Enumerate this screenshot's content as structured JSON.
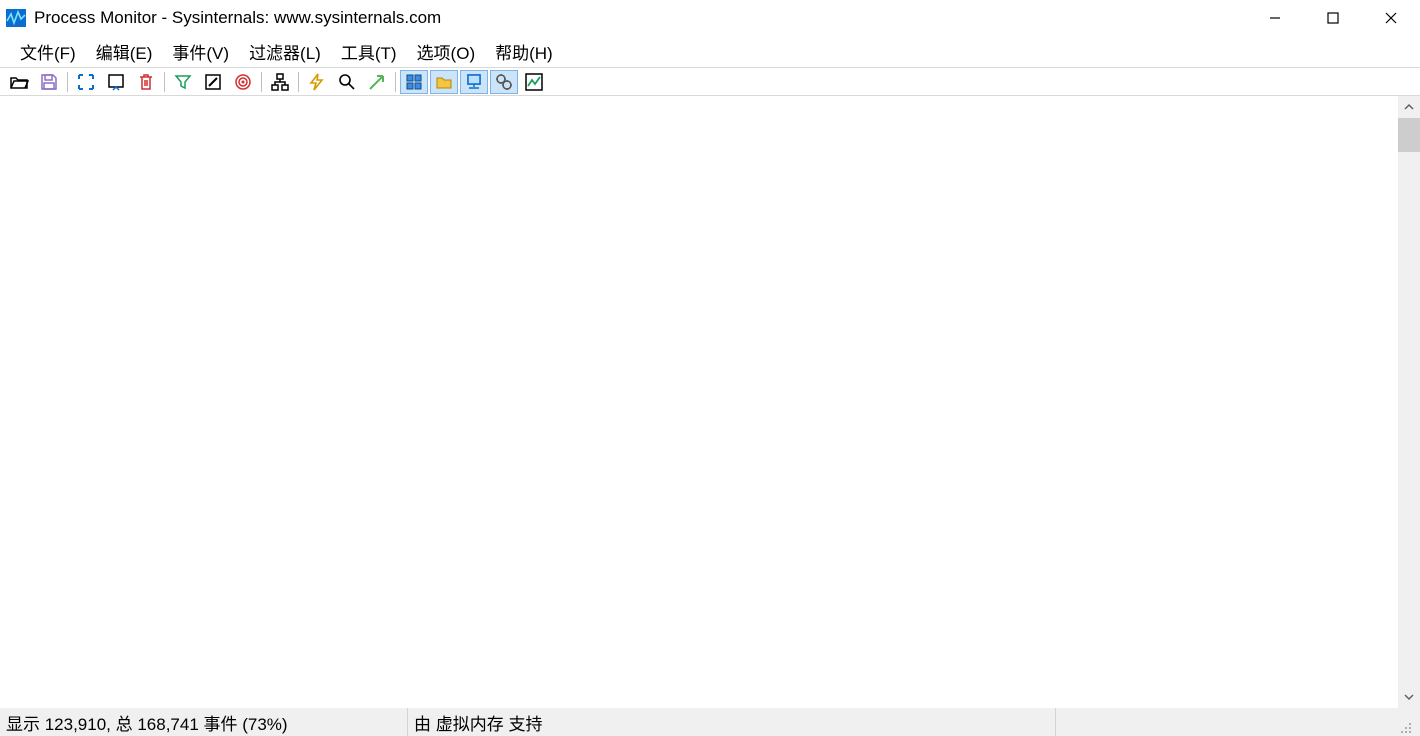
{
  "window": {
    "title": "Process Monitor - Sysinternals: www.sysinternals.com"
  },
  "menu": {
    "file": "文件(F)",
    "edit": "编辑(E)",
    "event": "事件(V)",
    "filter": "过滤器(L)",
    "tools": "工具(T)",
    "options": "选项(O)",
    "help": "帮助(H)"
  },
  "status": {
    "events": "显示 123,910, 总 168,741 事件 (73%)",
    "memory": "由 虚拟内存 支持"
  },
  "toolbar_active": {
    "registry": true,
    "filesystem": true,
    "network": true,
    "process": true,
    "profiling": false
  }
}
